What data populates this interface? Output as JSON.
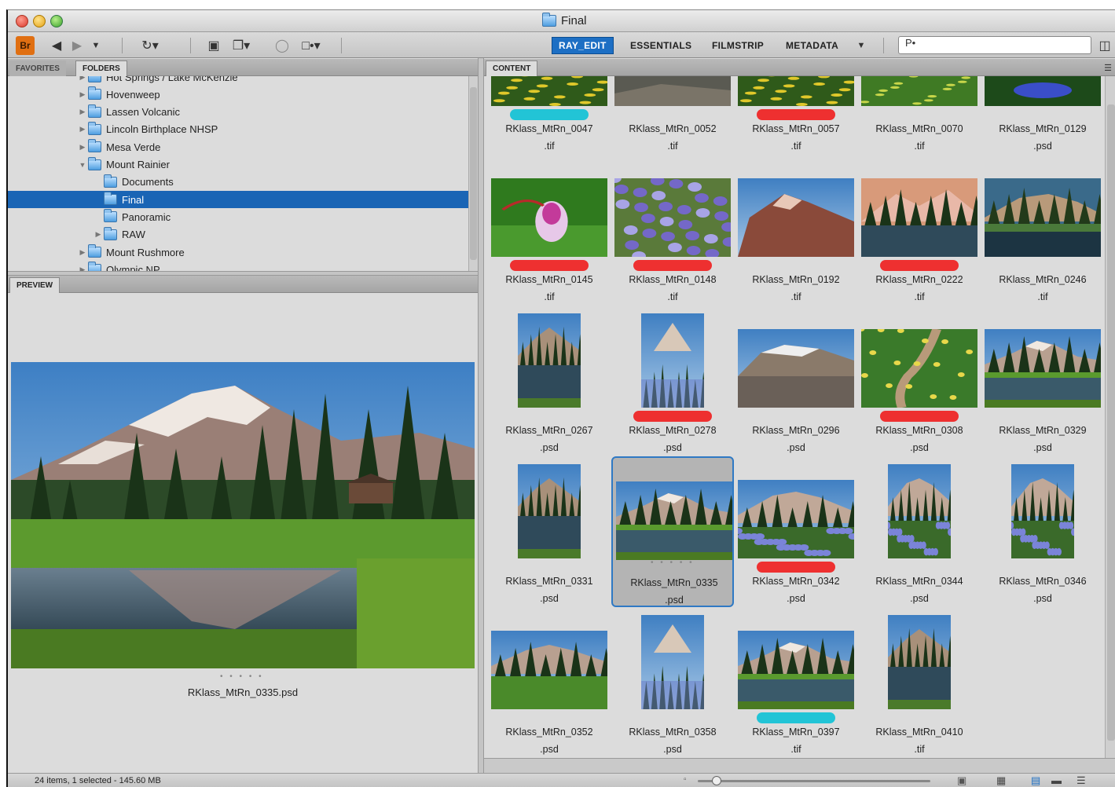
{
  "window": {
    "title": "Final"
  },
  "toolbar": {
    "logo": "Br",
    "workspaces": [
      "RAY_EDIT",
      "ESSENTIALS",
      "FILMSTRIP",
      "METADATA"
    ],
    "active_workspace": "RAY_EDIT",
    "search_placeholder": "P•"
  },
  "left_tabs": {
    "favorites": "FAVORITES",
    "folders": "FOLDERS"
  },
  "folders": [
    {
      "label": "Hot Springs / Lake McKenzie",
      "level": 0,
      "expand": "closed"
    },
    {
      "label": "Hovenweep",
      "level": 0,
      "expand": "closed"
    },
    {
      "label": "Lassen Volcanic",
      "level": 0,
      "expand": "closed"
    },
    {
      "label": "Lincoln Birthplace NHSP",
      "level": 0,
      "expand": "closed"
    },
    {
      "label": "Mesa Verde",
      "level": 0,
      "expand": "closed"
    },
    {
      "label": "Mount Rainier",
      "level": 0,
      "expand": "open"
    },
    {
      "label": "Documents",
      "level": 1,
      "expand": "none"
    },
    {
      "label": "Final",
      "level": 1,
      "expand": "none",
      "selected": true
    },
    {
      "label": "Panoramic",
      "level": 1,
      "expand": "none"
    },
    {
      "label": "RAW",
      "level": 1,
      "expand": "closed"
    },
    {
      "label": "Mount Rushmore",
      "level": 0,
      "expand": "closed"
    },
    {
      "label": "Olympic NP",
      "level": 0,
      "expand": "closed"
    }
  ],
  "preview": {
    "tab": "PREVIEW",
    "caption": "RKlass_MtRn_0335.psd",
    "rating": "• • • • •"
  },
  "content": {
    "tab": "CONTENT",
    "items": [
      {
        "name": "RKlass_MtRn_0047",
        "ext": ".tif",
        "label": "#22c4d6",
        "scene": "flowers-yellow",
        "orient": "partial"
      },
      {
        "name": "RKlass_MtRn_0052",
        "ext": ".tif",
        "label": "",
        "scene": "rock",
        "orient": "partial"
      },
      {
        "name": "RKlass_MtRn_0057",
        "ext": ".tif",
        "label": "#ee3030",
        "scene": "flowers-yellow",
        "orient": "partial"
      },
      {
        "name": "RKlass_MtRn_0070",
        "ext": ".tif",
        "label": "",
        "scene": "meadow",
        "orient": "partial"
      },
      {
        "name": "RKlass_MtRn_0129",
        "ext": ".psd",
        "label": "",
        "scene": "blue-flower",
        "orient": "partial"
      },
      {
        "name": "RKlass_MtRn_0145",
        "ext": ".tif",
        "label": "#ee3030",
        "scene": "pink-flower",
        "orient": "land"
      },
      {
        "name": "RKlass_MtRn_0148",
        "ext": ".tif",
        "label": "#ee3030",
        "scene": "lupine",
        "orient": "land"
      },
      {
        "name": "RKlass_MtRn_0192",
        "ext": ".tif",
        "label": "",
        "scene": "mountain-red",
        "orient": "land"
      },
      {
        "name": "RKlass_MtRn_0222",
        "ext": ".tif",
        "label": "#ee3030",
        "scene": "lake-sunset",
        "orient": "land"
      },
      {
        "name": "RKlass_MtRn_0246",
        "ext": ".tif",
        "label": "",
        "scene": "lake-dark",
        "orient": "land"
      },
      {
        "name": "RKlass_MtRn_0267",
        "ext": ".psd",
        "label": "",
        "scene": "lake-tall",
        "orient": "port"
      },
      {
        "name": "RKlass_MtRn_0278",
        "ext": ".psd",
        "label": "#ee3030",
        "scene": "forest-tall",
        "orient": "port"
      },
      {
        "name": "RKlass_MtRn_0296",
        "ext": ".psd",
        "label": "",
        "scene": "glacier",
        "orient": "land"
      },
      {
        "name": "RKlass_MtRn_0308",
        "ext": ".psd",
        "label": "#ee3030",
        "scene": "trail",
        "orient": "land"
      },
      {
        "name": "RKlass_MtRn_0329",
        "ext": ".psd",
        "label": "",
        "scene": "lake",
        "orient": "land"
      },
      {
        "name": "RKlass_MtRn_0331",
        "ext": ".psd",
        "label": "",
        "scene": "lake-tall",
        "orient": "port"
      },
      {
        "name": "RKlass_MtRn_0335",
        "ext": ".psd",
        "label": "",
        "scene": "lake",
        "orient": "land",
        "selected": true
      },
      {
        "name": "RKlass_MtRn_0342",
        "ext": ".psd",
        "label": "#ee3030",
        "scene": "lupine-mtn",
        "orient": "land"
      },
      {
        "name": "RKlass_MtRn_0344",
        "ext": ".psd",
        "label": "",
        "scene": "lupine-mtn",
        "orient": "port"
      },
      {
        "name": "RKlass_MtRn_0346",
        "ext": ".psd",
        "label": "",
        "scene": "lupine-mtn",
        "orient": "port"
      },
      {
        "name": "RKlass_MtRn_0352",
        "ext": ".psd",
        "label": "",
        "scene": "meadow-mtn",
        "orient": "land"
      },
      {
        "name": "RKlass_MtRn_0358",
        "ext": ".psd",
        "label": "",
        "scene": "forest-tall",
        "orient": "port"
      },
      {
        "name": "RKlass_MtRn_0397",
        "ext": ".tif",
        "label": "#22c4d6",
        "scene": "lake",
        "orient": "land"
      },
      {
        "name": "RKlass_MtRn_0410",
        "ext": ".tif",
        "label": "",
        "scene": "lake-tall",
        "orient": "port"
      }
    ]
  },
  "status": {
    "text": "24 items, 1 selected - 145.60 MB",
    "zoom_level": 0.08
  }
}
